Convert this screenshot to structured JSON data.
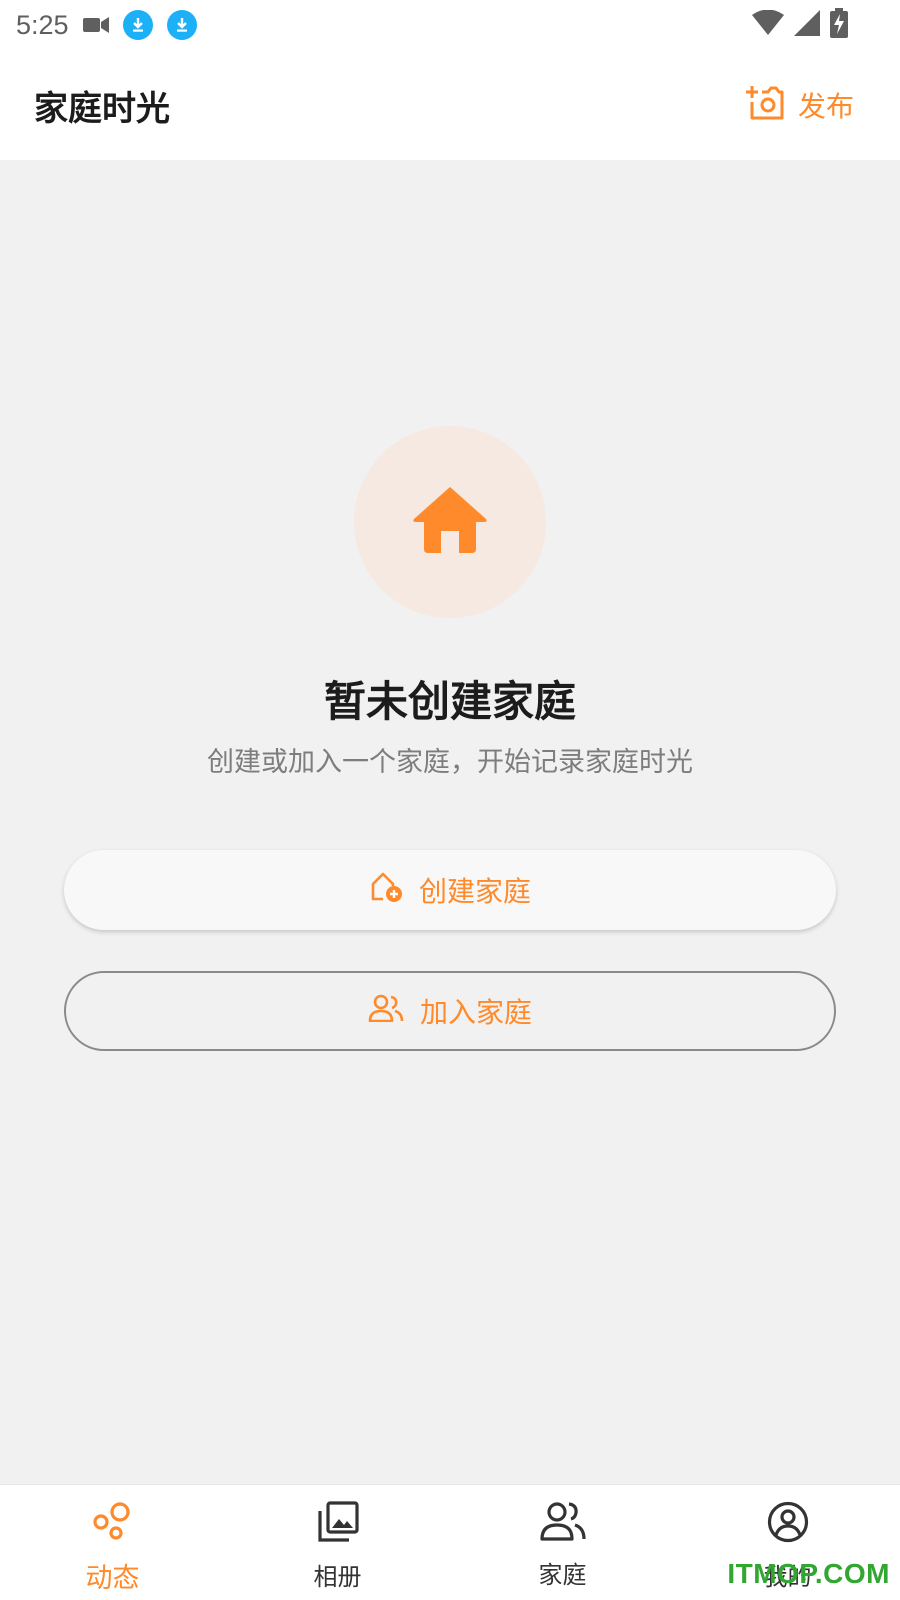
{
  "status_bar": {
    "time": "5:25",
    "icons": [
      "video-icon",
      "download-icon",
      "download-icon",
      "wifi-icon",
      "signal-icon",
      "battery-icon"
    ]
  },
  "header": {
    "title": "家庭时光",
    "publish_label": "发布"
  },
  "empty_state": {
    "icon": "home-icon",
    "title": "暂未创建家庭",
    "subtitle": "创建或加入一个家庭，开始记录家庭时光"
  },
  "actions": {
    "create_label": "创建家庭",
    "join_label": "加入家庭"
  },
  "bottom_nav": {
    "items": [
      {
        "label": "动态",
        "icon": "moments-icon",
        "active": true
      },
      {
        "label": "相册",
        "icon": "album-icon",
        "active": false
      },
      {
        "label": "家庭",
        "icon": "family-icon",
        "active": false
      },
      {
        "label": "我的",
        "icon": "profile-icon",
        "active": false
      }
    ]
  },
  "watermark": "ITMOP.COM",
  "colors": {
    "accent": "#ff8a2b",
    "background": "#f1f1f1",
    "icon_circle": "#f5e9e1",
    "status_download": "#1cb0f6"
  }
}
